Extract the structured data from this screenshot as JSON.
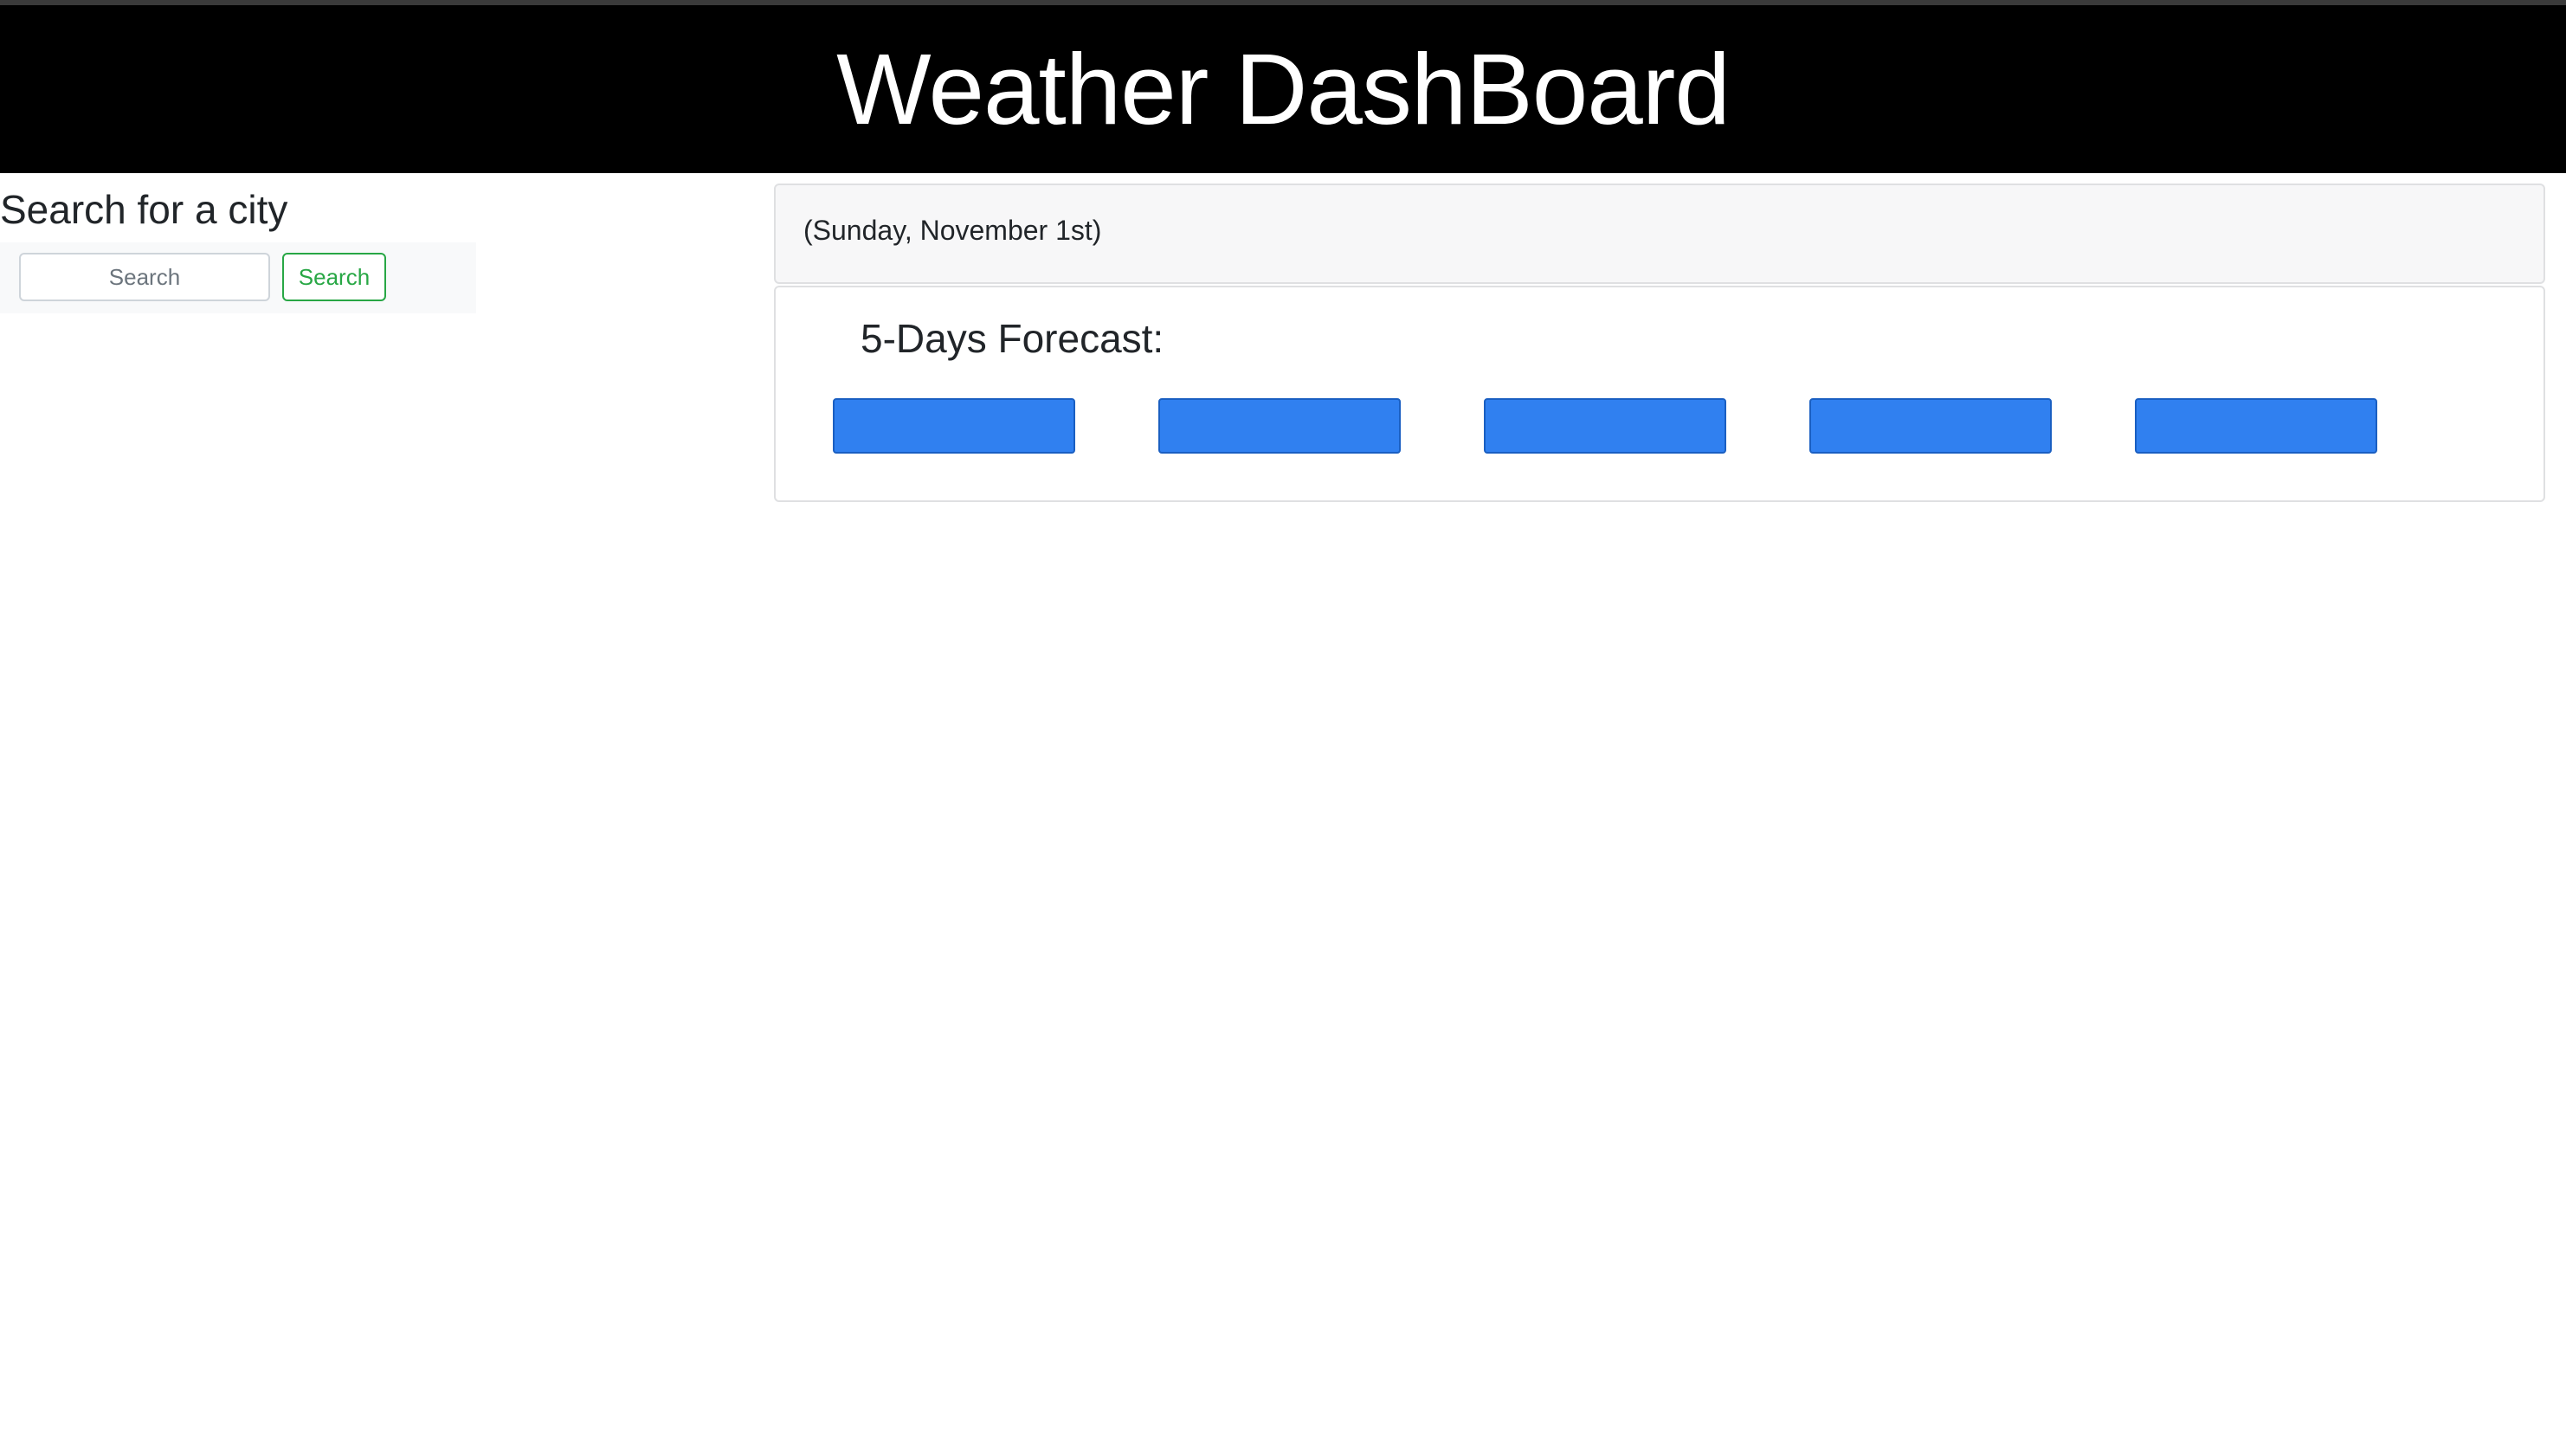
{
  "header": {
    "title": "Weather DashBoard"
  },
  "sidebar": {
    "heading": "Search for a city",
    "search": {
      "placeholder": "Search",
      "value": "",
      "button_label": "Search"
    }
  },
  "current": {
    "date_label": "(Sunday, November 1st)"
  },
  "forecast": {
    "heading": "5-Days Forecast:",
    "days": [
      "",
      "",
      "",
      "",
      ""
    ]
  },
  "colors": {
    "header_bg": "#000000",
    "header_text": "#ffffff",
    "forecast_card": "#3080f0",
    "search_button": "#28a745"
  }
}
